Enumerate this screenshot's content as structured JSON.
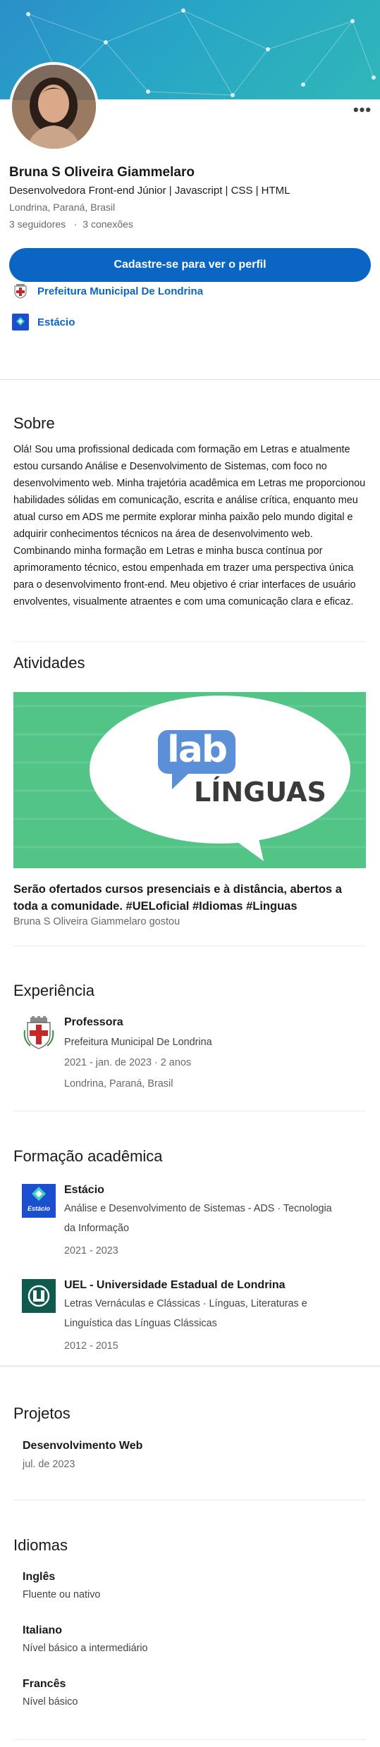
{
  "profile": {
    "name": "Bruna S Oliveira Giammelaro",
    "headline": "Desenvolvedora Front-end Júnior | Javascript | CSS | HTML",
    "location": "Londrina, Paraná, Brasil",
    "followers": "3 seguidores",
    "connections": "3 conexões",
    "cta_label": "Cadastre-se para ver o perfil",
    "more_label": "•••"
  },
  "top_orgs": [
    {
      "name": "Prefeitura Municipal De Londrina",
      "icon": "city-crest-icon"
    },
    {
      "name": "Estácio",
      "icon": "estacio-logo-icon"
    }
  ],
  "about": {
    "title": "Sobre",
    "text": "Olá! Sou uma profissional dedicada com formação em Letras e atualmente estou cursando Análise e Desenvolvimento de Sistemas, com foco no desenvolvimento web. Minha trajetória acadêmica em Letras me proporcionou habilidades sólidas em comunicação, escrita e análise crítica, enquanto meu atual curso em ADS me permite explorar minha paixão pelo mundo digital e adquirir conhecimentos técnicos na área de desenvolvimento web. Combinando minha formação em Letras e minha busca contínua por aprimoramento técnico, estou empenhada em trazer uma perspectiva única para o desenvolvimento front-end. Meu objetivo é criar interfaces de usuário envolventes, visualmente atraentes e com uma comunicação clara e eficaz."
  },
  "activities": {
    "title": "Atividades",
    "image_logo_word": "lab",
    "image_text": "LÍNGUAS",
    "post_text": "Serão ofertados cursos presenciais e à distância, abertos a toda a comunidade. #UELoficial #Idiomas #Linguas",
    "post_sub": "Bruna S Oliveira Giammelaro gostou"
  },
  "experience": {
    "title": "Experiência",
    "items": [
      {
        "role": "Professora",
        "org": "Prefeitura Municipal De Londrina",
        "dates": "2021 - jan. de 2023 · 2 anos",
        "location": "Londrina, Paraná, Brasil",
        "icon": "city-crest-icon"
      }
    ]
  },
  "education": {
    "title": "Formação acadêmica",
    "items": [
      {
        "school": "Estácio",
        "degree_line1": "Análise e Desenvolvimento de Sistemas - ADS · Tecnologia",
        "degree_line2": "da Informação",
        "dates": "2021 - 2023",
        "logo_text": "Estácio",
        "icon": "estacio-logo-icon"
      },
      {
        "school": "UEL - Universidade Estadual de Londrina",
        "degree_line1": "Letras Vernáculas e Clássicas · Línguas, Literaturas e",
        "degree_line2": "Linguística das Línguas Clássicas",
        "dates": "2012 - 2015",
        "icon": "uel-logo-icon"
      }
    ]
  },
  "projects": {
    "title": "Projetos",
    "items": [
      {
        "name": "Desenvolvimento Web",
        "date": "jul. de 2023"
      }
    ]
  },
  "languages": {
    "title": "Idiomas",
    "items": [
      {
        "name": "Inglês",
        "level": "Fluente ou nativo"
      },
      {
        "name": "Italiano",
        "level": "Nível básico a intermediário"
      },
      {
        "name": "Francês",
        "level": "Nível básico"
      }
    ]
  },
  "colors": {
    "accent": "#0a66c2",
    "banner_start": "#2a8fc9",
    "banner_end": "#2fb7b8",
    "estacio_blue": "#1b4fcf",
    "uel_green": "#0f5a4e"
  }
}
